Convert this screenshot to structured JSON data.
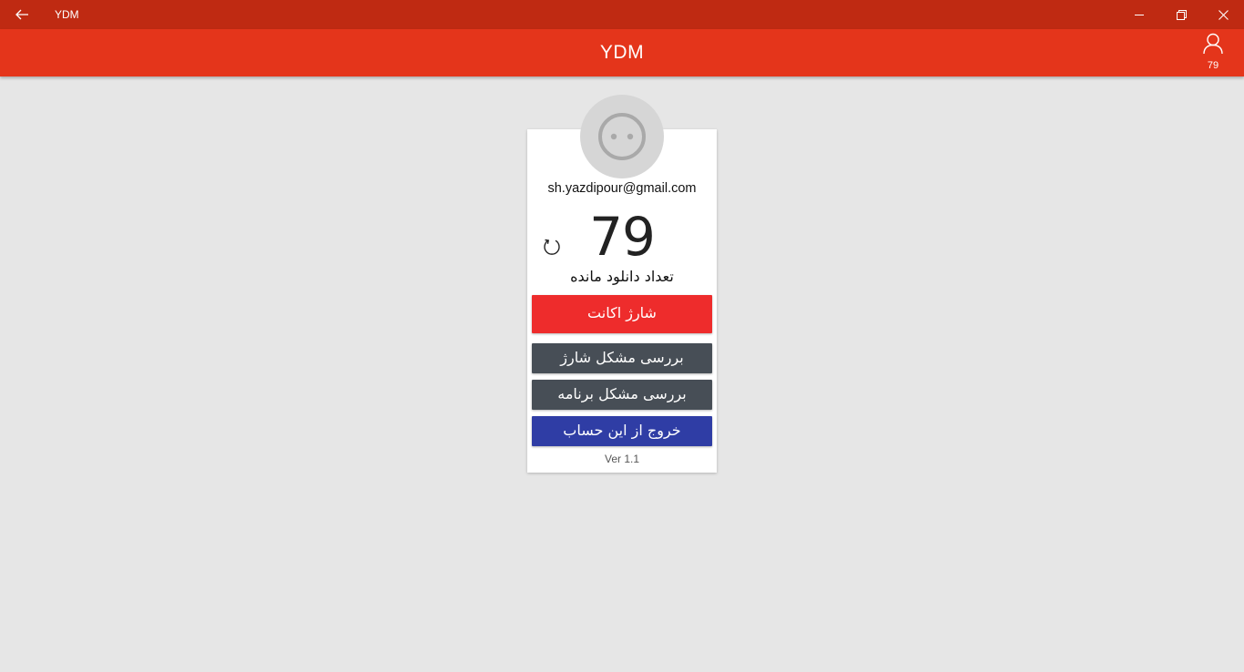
{
  "window": {
    "title": "YDM",
    "back_icon": "back-arrow-icon",
    "minimize_icon": "minimize-icon",
    "maximize_icon": "restore-icon",
    "close_icon": "close-icon"
  },
  "header": {
    "title": "YDM",
    "account_icon": "person-icon",
    "account_count": "79"
  },
  "card": {
    "avatar_icon": "avatar-icon",
    "email": "sh.yazdipour@gmail.com",
    "count": "79",
    "refresh_icon": "refresh-icon",
    "remaining_label": "تعداد دانلود مانده",
    "buttons": {
      "charge": "شارژ اکانت",
      "charge_problem": "بررسی مشکل شارژ",
      "app_problem": "بررسی مشکل برنامه",
      "logout": "خروج از این حساب"
    },
    "version": "Ver 1.1"
  },
  "colors": {
    "titlebar": "#bf2a12",
    "appbar": "#e4351b",
    "charge_button": "#ee2c2c",
    "gray_button": "#474e56",
    "logout_button": "#2f3da5",
    "background": "#e6e6e6"
  }
}
